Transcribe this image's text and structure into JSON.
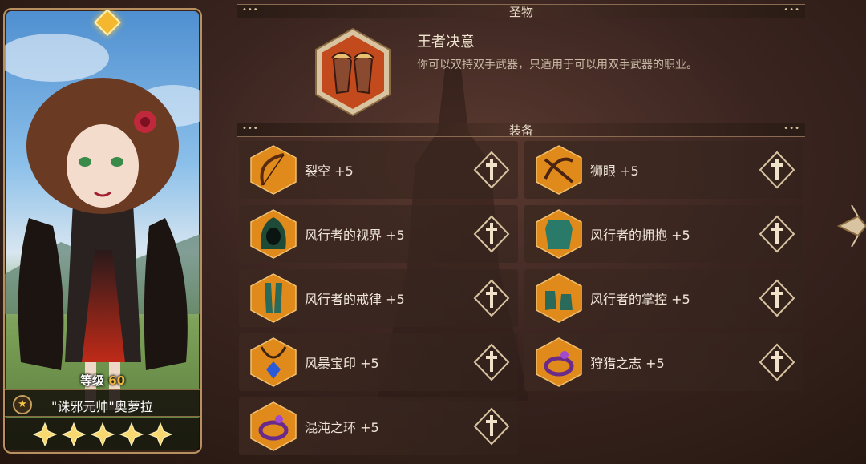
{
  "hero": {
    "level_label": "等级",
    "level_value": "60",
    "name": "\"诛邪元帅\"奥萝拉",
    "star_count": 5
  },
  "relic_section": {
    "title": "圣物",
    "relic_name": "王者决意",
    "relic_desc": "你可以双持双手武器，只适用于可以用双手武器的职业。",
    "icon": "gauntlets-icon"
  },
  "equipment_section": {
    "title": "装备",
    "items": [
      {
        "name": "裂空 +5",
        "icon": "bow-icon",
        "type_icon": "weapon-slot-icon"
      },
      {
        "name": "狮眼 +5",
        "icon": "crossbow-icon",
        "type_icon": "weapon-slot-icon"
      },
      {
        "name": "风行者的视界 +5",
        "icon": "hood-icon",
        "type_icon": "helmet-slot-icon"
      },
      {
        "name": "风行者的拥抱 +5",
        "icon": "armor-icon",
        "type_icon": "chest-slot-icon"
      },
      {
        "name": "风行者的戒律 +5",
        "icon": "leggings-icon",
        "type_icon": "pants-slot-icon"
      },
      {
        "name": "风行者的掌控 +5",
        "icon": "boots-icon",
        "type_icon": "boots-slot-icon"
      },
      {
        "name": "风暴宝印 +5",
        "icon": "amulet-icon",
        "type_icon": "necklace-slot-icon"
      },
      {
        "name": "狩猎之志 +5",
        "icon": "ring-icon",
        "type_icon": "ring-slot-icon"
      },
      {
        "name": "混沌之环 +5",
        "icon": "ring-icon",
        "type_icon": "ring-slot-icon"
      }
    ]
  },
  "colors": {
    "accent_gold": "#f0b83c",
    "icon_orange": "#e08a1c",
    "panel_border": "#b89060"
  }
}
